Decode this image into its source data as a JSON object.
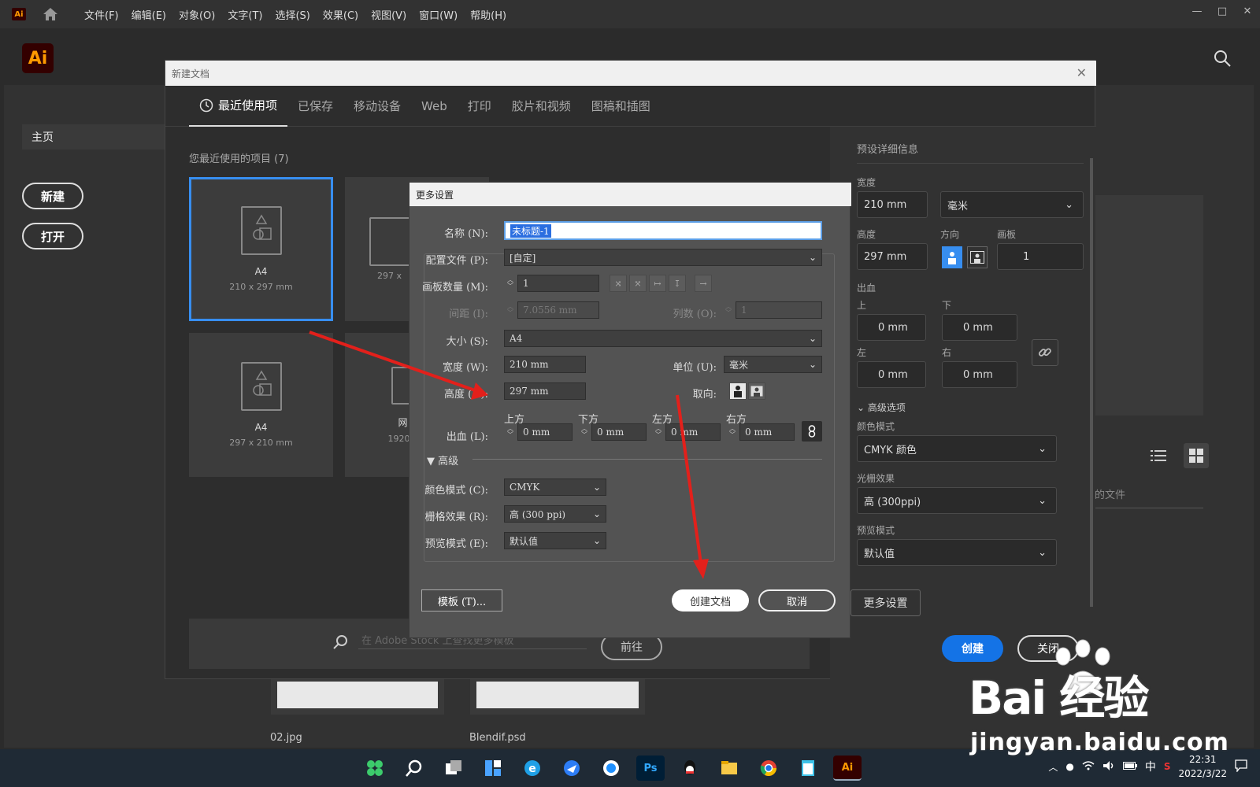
{
  "menubar": {
    "app_badge": "Ai",
    "menus": [
      "文件(F)",
      "编辑(E)",
      "对象(O)",
      "文字(T)",
      "选择(S)",
      "效果(C)",
      "视图(V)",
      "窗口(W)",
      "帮助(H)"
    ],
    "window_controls": [
      "—",
      "□",
      "✕"
    ]
  },
  "home": {
    "logo": "Ai",
    "sidebar_home": "主页",
    "new_button": "新建",
    "open_button": "打开",
    "thumbnails": [
      {
        "label": "02.jpg"
      },
      {
        "label": "Blendif.psd"
      }
    ],
    "recent_files_partial": "的文件"
  },
  "new_doc": {
    "title": "新建文档",
    "tabs": [
      "最近使用项",
      "已保存",
      "移动设备",
      "Web",
      "打印",
      "胶片和视频",
      "图稿和插图"
    ],
    "recent_label": "您最近使用的项目 (7)",
    "cards": [
      {
        "name": "A4",
        "size": "210 x 297 mm"
      },
      {
        "name": "",
        "size": "297 x"
      },
      {
        "name": "A4",
        "size": "297 x 210 mm"
      },
      {
        "name": "网",
        "size": "1920 x"
      }
    ],
    "stock_placeholder": "在 Adobe Stock 上查找更多模板",
    "stock_button": "前往",
    "preset": {
      "header": "预设详细信息",
      "width_label": "宽度",
      "width_value": "210 mm",
      "unit_value": "毫米",
      "height_label": "高度",
      "height_value": "297 mm",
      "orientation_label": "方向",
      "artboard_label": "画板",
      "artboard_value": "1",
      "bleed_label": "出血",
      "top_label": "上",
      "top_value": "0 mm",
      "bottom_label": "下",
      "bottom_value": "0 mm",
      "left_label": "左",
      "left_value": "0 mm",
      "right_label": "右",
      "right_value": "0 mm",
      "advanced_label": "高级选项",
      "color_mode_label": "颜色模式",
      "color_mode_value": "CMYK 颜色",
      "raster_label": "光栅效果",
      "raster_value": "高 (300ppi)",
      "preview_label": "预览模式",
      "preview_value": "默认值",
      "more_settings": "更多设置",
      "create": "创建",
      "close": "关闭"
    }
  },
  "more_settings": {
    "title": "更多设置",
    "name_label": "名称 (N):",
    "name_value": "未标题-1",
    "profile_label": "配置文件 (P):",
    "profile_value": "[自定]",
    "artboards_label": "画板数量 (M):",
    "artboards_value": "1",
    "spacing_label": "间距 (I):",
    "spacing_value": "7.0556 mm",
    "columns_label": "列数 (O):",
    "columns_value": "1",
    "size_label": "大小 (S):",
    "size_value": "A4",
    "width_label": "宽度 (W):",
    "width_value": "210 mm",
    "unit_label": "单位 (U):",
    "unit_value": "毫米",
    "height_label": "高度 (H):",
    "height_value": "297 mm",
    "orient_label": "取向:",
    "bleed_label": "出血 (L):",
    "bleed_top_label": "上方",
    "bleed_bottom_label": "下方",
    "bleed_left_label": "左方",
    "bleed_right_label": "右方",
    "bleed_value": "0 mm",
    "advanced": "高级",
    "color_label": "颜色模式 (C):",
    "color_value": "CMYK",
    "raster_label": "栅格效果 (R):",
    "raster_value": "高 (300 ppi)",
    "preview_label": "预览模式 (E):",
    "preview_value": "默认值",
    "template_button": "模板 (T)...",
    "create_button": "创建文档",
    "cancel_button": "取消"
  },
  "taskbar": {
    "apps": [
      "start",
      "search",
      "task-view",
      "widgets",
      "edge",
      "feishu",
      "qq-browser",
      "Ps",
      "qq",
      "explorer",
      "chrome",
      "notepad",
      "Ai"
    ],
    "tray_lang": "中",
    "time": "22:31",
    "date": "2022/3/22"
  },
  "watermark": {
    "brand": "Bai 经验",
    "url": "jingyan.baidu.com"
  },
  "colors": {
    "accent": "#1473e6",
    "selection_border": "#378ef0",
    "annotation_arrow": "#e3201b",
    "ai_orange": "#ff9a00",
    "ai_bg": "#330000"
  }
}
